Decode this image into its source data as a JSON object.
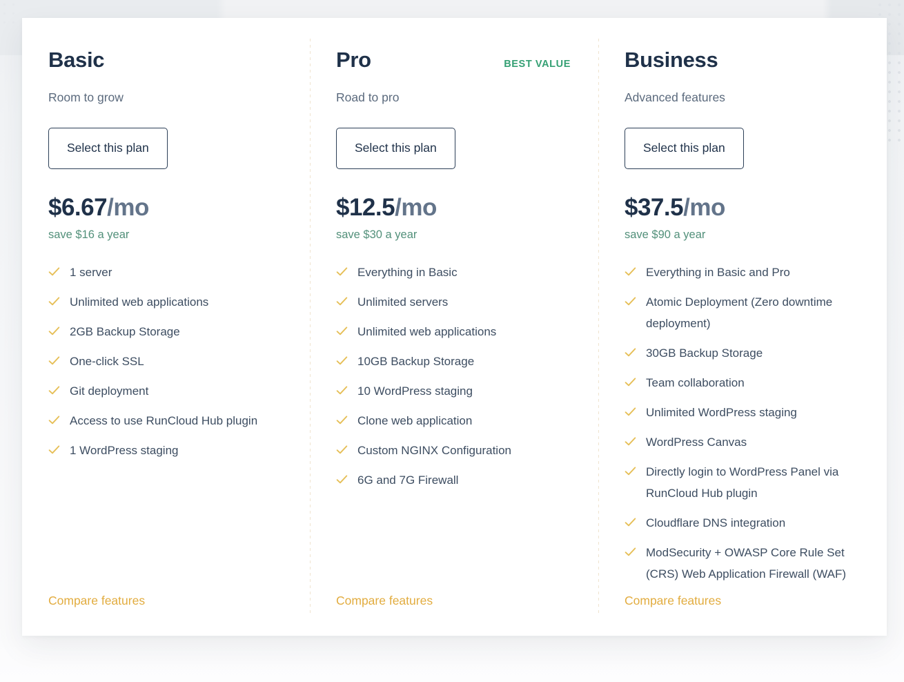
{
  "theme": {
    "heading_color": "#1f3149",
    "body_text_color": "#3d4d61",
    "muted_color": "#5b6a7d",
    "badge_green": "#35a074",
    "save_green": "#52907a",
    "check_amber": "#e6bf57",
    "link_amber": "#e2ac3f",
    "card_bg": "#ffffff",
    "page_bg": "#f2f4f6"
  },
  "plans": [
    {
      "name": "Basic",
      "badge": "",
      "tagline": "Room to grow",
      "cta_label": "Select this plan",
      "price_amount": "$6.67",
      "price_period": "/mo",
      "save_text": "save $16 a year",
      "features": [
        "1 server",
        "Unlimited web applications",
        "2GB Backup Storage",
        "One-click SSL",
        "Git deployment",
        "Access to use RunCloud Hub plugin",
        "1 WordPress staging"
      ],
      "compare_label": "Compare features"
    },
    {
      "name": "Pro",
      "badge": "BEST VALUE",
      "tagline": "Road to pro",
      "cta_label": "Select this plan",
      "price_amount": "$12.5",
      "price_period": "/mo",
      "save_text": "save $30 a year",
      "features": [
        "Everything in Basic",
        "Unlimited servers",
        "Unlimited web applications",
        "10GB Backup Storage",
        "10 WordPress staging",
        "Clone web application",
        "Custom NGINX Configuration",
        "6G and 7G Firewall"
      ],
      "compare_label": "Compare features"
    },
    {
      "name": "Business",
      "badge": "",
      "tagline": "Advanced features",
      "cta_label": "Select this plan",
      "price_amount": "$37.5",
      "price_period": "/mo",
      "save_text": "save $90 a year",
      "features": [
        "Everything in Basic and Pro",
        "Atomic Deployment (Zero downtime deployment)",
        "30GB Backup Storage",
        "Team collaboration",
        "Unlimited WordPress staging",
        "WordPress Canvas",
        "Directly login to WordPress Panel via RunCloud Hub plugin",
        "Cloudflare DNS integration",
        "ModSecurity + OWASP Core Rule Set (CRS) Web Application Firewall (WAF)"
      ],
      "compare_label": "Compare features"
    }
  ],
  "icons": {
    "check": "check-icon"
  }
}
